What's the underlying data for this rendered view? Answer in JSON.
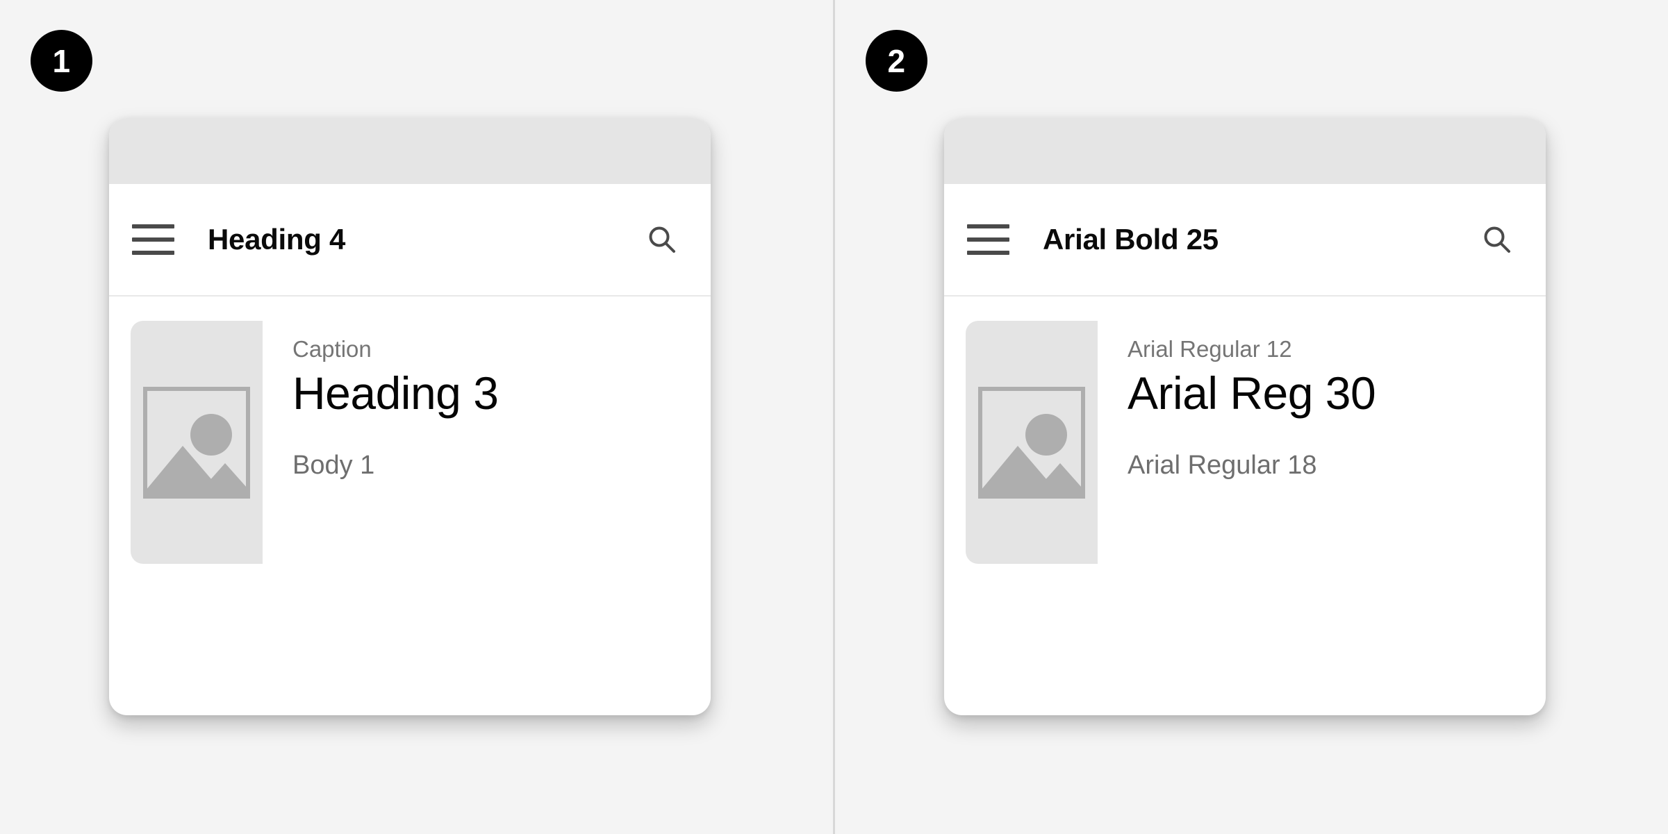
{
  "background_color": "#f4f4f4",
  "divider_color": "#d8d8d8",
  "panels": [
    {
      "badge": "1",
      "card": {
        "app_bar": {
          "menu_icon": "hamburger-menu-icon",
          "title": "Heading 4",
          "search_icon": "search-icon"
        },
        "content": {
          "media_icon": "image-placeholder-icon",
          "caption": "Caption",
          "headline": "Heading 3",
          "body": "Body 1"
        }
      }
    },
    {
      "badge": "2",
      "card": {
        "app_bar": {
          "menu_icon": "hamburger-menu-icon",
          "title": "Arial Bold 25",
          "search_icon": "search-icon"
        },
        "content": {
          "media_icon": "image-placeholder-icon",
          "caption": "Arial Regular 12",
          "headline": "Arial Reg 30",
          "body": "Arial Regular 18"
        }
      }
    }
  ],
  "colors": {
    "status_bar": "#e5e5e5",
    "card_surface": "#ffffff",
    "media_block": "#e4e4e4",
    "icon_grey": "#4a4a4a",
    "placeholder_grey": "#aeaeae",
    "caption_grey": "#757575",
    "body_grey": "#6e6e6e",
    "headline_black": "#050505",
    "badge_background": "#000000",
    "badge_text": "#ffffff"
  }
}
